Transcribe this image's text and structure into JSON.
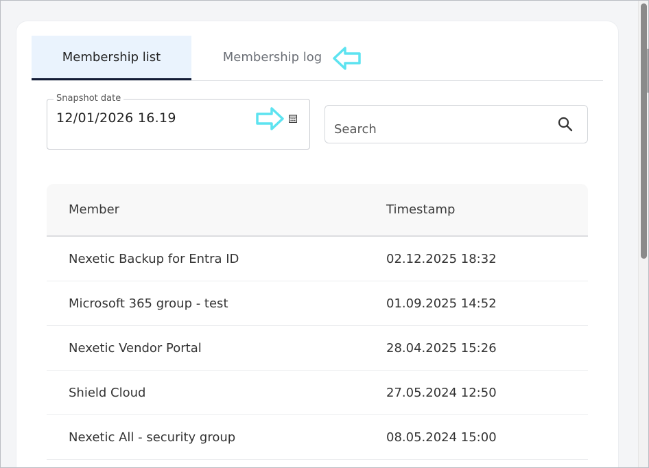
{
  "tabs": [
    {
      "label": "Membership list",
      "active": true
    },
    {
      "label": "Membership log",
      "active": false
    }
  ],
  "snapshot": {
    "label": "Snapshot date",
    "value": "12/01/2026  16.19"
  },
  "search": {
    "placeholder": "Search"
  },
  "table": {
    "headers": [
      "Member",
      "Timestamp"
    ],
    "rows": [
      [
        "Nexetic Backup for Entra ID",
        "02.12.2025 18:32"
      ],
      [
        "Microsoft 365 group - test",
        "01.09.2025 14:52"
      ],
      [
        "Nexetic Vendor Portal",
        "28.04.2025 15:26"
      ],
      [
        "Shield Cloud",
        "27.05.2024 12:50"
      ],
      [
        "Nexetic All - security group",
        "08.05.2024 15:00"
      ]
    ]
  },
  "colors": {
    "annotation_arrow": "#5de3f0",
    "active_tab_bg": "#eaf3fd",
    "active_tab_underline": "#131c36"
  },
  "icons": [
    "calendar-icon",
    "search-icon",
    "annotation-arrow-left",
    "annotation-arrow-right"
  ]
}
